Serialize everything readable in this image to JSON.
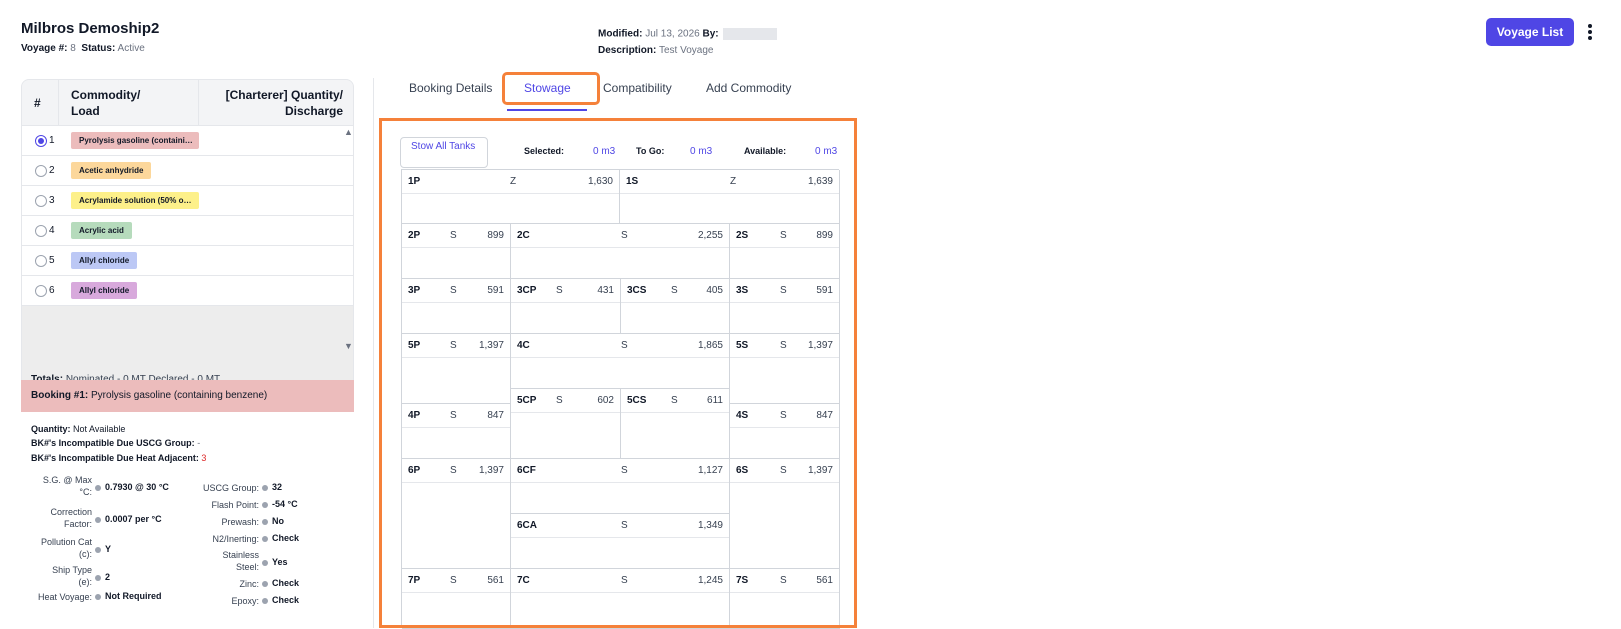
{
  "header": {
    "title": "Milbros Demoship2",
    "voyage_label": "Voyage #:",
    "voyage_num": "8",
    "status_label": "Status:",
    "status": "Active",
    "modified_label": "Modified:",
    "modified": "Jul 13, 2026",
    "by_label": "By:",
    "description_label": "Description:",
    "description": "Test Voyage",
    "voyage_list_button": "Voyage List"
  },
  "commodity_table": {
    "col_num": "#",
    "col_commodity_1": "Commodity/",
    "col_commodity_2": "Load",
    "col_qty_1": "[Charterer] Quantity/",
    "col_qty_2": "Discharge",
    "rows": [
      {
        "num": "1",
        "name": "Pyrolysis gasoline (containi…",
        "color": "#ecbcbc",
        "selected": true
      },
      {
        "num": "2",
        "name": "Acetic anhydride",
        "color": "#fcd79b",
        "selected": false
      },
      {
        "num": "3",
        "name": "Acrylamide solution (50% o…",
        "color": "#fdf08a",
        "selected": false
      },
      {
        "num": "4",
        "name": "Acrylic acid",
        "color": "#b6dbbc",
        "selected": false
      },
      {
        "num": "5",
        "name": "Allyl chloride",
        "color": "#bcc8f5",
        "selected": false
      },
      {
        "num": "6",
        "name": "Allyl chloride",
        "color": "#d8a9dc",
        "selected": false
      }
    ]
  },
  "totals": {
    "label": "Totals:",
    "text": "Nominated - 0 MT Declared - 0 MT"
  },
  "booking": {
    "label": "Booking #1:",
    "name": "Pyrolysis gasoline (containing benzene)",
    "color": "#ecbcbc"
  },
  "booking_info": {
    "quantity_label": "Quantity:",
    "quantity": "Not Available",
    "uscg_label": "BK#'s Incompatible Due USCG Group:",
    "uscg": "-",
    "heat_label": "BK#'s Incompatible Due Heat Adjacent:",
    "heat": "3"
  },
  "specs_left": [
    {
      "label_1": "S.G. @ Max",
      "label_2": "°C:",
      "value": "0.7930 @ 30 °C"
    },
    {
      "label_1": "Correction",
      "label_2": "Factor:",
      "value": "0.0007 per °C"
    },
    {
      "label_1": "Pollution Cat",
      "label_2": "(c):",
      "value": "Y"
    },
    {
      "label_1": "Ship Type",
      "label_2": "(e):",
      "value": "2"
    },
    {
      "label_1": "Heat Voyage:",
      "label_2": "",
      "value": "Not Required"
    }
  ],
  "specs_right": [
    {
      "label_1": "USCG Group:",
      "label_2": "",
      "value": "32"
    },
    {
      "label_1": "Flash Point:",
      "label_2": "",
      "value": "-54 °C"
    },
    {
      "label_1": "Prewash:",
      "label_2": "",
      "value": "No"
    },
    {
      "label_1": "N2/Inerting:",
      "label_2": "",
      "value": "Check"
    },
    {
      "label_1": "Stainless",
      "label_2": "Steel:",
      "value": "Yes"
    },
    {
      "label_1": "Zinc:",
      "label_2": "",
      "value": "Check"
    },
    {
      "label_1": "Epoxy:",
      "label_2": "",
      "value": "Check"
    }
  ],
  "tabs": [
    "Booking Details",
    "Stowage",
    "Compatibility",
    "Add Commodity"
  ],
  "active_tab": "Stowage",
  "stowage": {
    "stow_all_button": "Stow All Tanks",
    "selected_label": "Selected:",
    "selected": "0 m3",
    "togo_label": "To Go:",
    "togo": "0 m3",
    "available_label": "Available:",
    "available": "0 m3",
    "tanks": [
      {
        "name": "1P",
        "group": "Z",
        "qty": "1,630"
      },
      {
        "name": "1S",
        "group": "Z",
        "qty": "1,639"
      },
      {
        "name": "2P",
        "group": "S",
        "qty": "899"
      },
      {
        "name": "2C",
        "group": "S",
        "qty": "2,255"
      },
      {
        "name": "2S",
        "group": "S",
        "qty": "899"
      },
      {
        "name": "3P",
        "group": "S",
        "qty": "591"
      },
      {
        "name": "3CP",
        "group": "S",
        "qty": "431"
      },
      {
        "name": "3CS",
        "group": "S",
        "qty": "405"
      },
      {
        "name": "3S",
        "group": "S",
        "qty": "591"
      },
      {
        "name": "5P",
        "group": "S",
        "qty": "1,397"
      },
      {
        "name": "4C",
        "group": "S",
        "qty": "1,865"
      },
      {
        "name": "5S",
        "group": "S",
        "qty": "1,397"
      },
      {
        "name": "5CP",
        "group": "S",
        "qty": "602"
      },
      {
        "name": "5CS",
        "group": "S",
        "qty": "611"
      },
      {
        "name": "4P",
        "group": "S",
        "qty": "847"
      },
      {
        "name": "4S",
        "group": "S",
        "qty": "847"
      },
      {
        "name": "6P",
        "group": "S",
        "qty": "1,397"
      },
      {
        "name": "6CF",
        "group": "S",
        "qty": "1,127"
      },
      {
        "name": "6S",
        "group": "S",
        "qty": "1,397"
      },
      {
        "name": "6CA",
        "group": "S",
        "qty": "1,349"
      },
      {
        "name": "7P",
        "group": "S",
        "qty": "561"
      },
      {
        "name": "7C",
        "group": "S",
        "qty": "1,245"
      },
      {
        "name": "7S",
        "group": "S",
        "qty": "561"
      }
    ]
  },
  "colors": {
    "accent": "#4f46e5",
    "highlight": "#f5813a"
  }
}
